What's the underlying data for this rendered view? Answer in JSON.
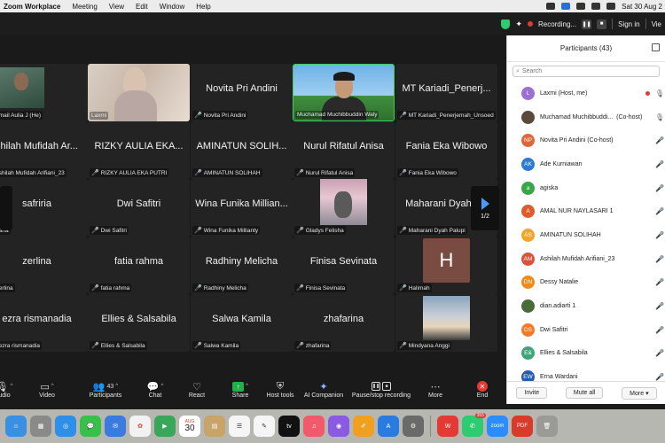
{
  "menubar": {
    "items": [
      "Zoom Workplace",
      "Meeting",
      "View",
      "Edit",
      "Window",
      "Help"
    ],
    "datetime": "Sat 30 Aug 2"
  },
  "titlebar": {
    "recording": "Recording...",
    "signin": "Sign in",
    "view": "Vie"
  },
  "grid": {
    "tiles": [
      {
        "name": "",
        "label": "mail Aulia J (He)",
        "kind": "photo-aulia"
      },
      {
        "name": "",
        "label": "Laxmi",
        "kind": "photo-laxmi"
      },
      {
        "name": "Novita Pri Andini",
        "label": "Novita Pri Andini",
        "kind": "text"
      },
      {
        "name": "",
        "label": "Muchamad Muchibbuddin Waly",
        "kind": "photo-muh"
      },
      {
        "name": "MT Kariadi_Penerj...",
        "label": "MT Kariadi_Penerjemah_Unsoed",
        "kind": "text"
      },
      {
        "name": "shilah Mufidah Ar...",
        "label": "shilah Mufidah Arifiani_23",
        "kind": "text"
      },
      {
        "name": "RIZKY AULIA EKA...",
        "label": "RIZKY AULIA EKA PUTRI",
        "kind": "text"
      },
      {
        "name": "AMINATUN SOLIH...",
        "label": "AMINATUN SOLIHAH",
        "kind": "text"
      },
      {
        "name": "Nurul Rifatul Anisa",
        "label": "Nurul Rifatul Anisa",
        "kind": "text"
      },
      {
        "name": "Fania Eka Wibowo",
        "label": "Fania Eka Wibowo",
        "kind": "text"
      },
      {
        "name": "safriria",
        "label": "aria",
        "kind": "text"
      },
      {
        "name": "Dwi Safitri",
        "label": "Dwi Safitri",
        "kind": "text"
      },
      {
        "name": "Wina Funika Millian...",
        "label": "Wina Funika Millianty",
        "kind": "text"
      },
      {
        "name": "",
        "label": "Gladys Felisha",
        "kind": "photo-gladys"
      },
      {
        "name": "Maharani Dyah P...",
        "label": "Maharani Dyah Palupi",
        "kind": "text"
      },
      {
        "name": "zerlina",
        "label": "erlina",
        "kind": "text"
      },
      {
        "name": "fatia rahma",
        "label": "fatia rahma",
        "kind": "text"
      },
      {
        "name": "Radhiny Melicha",
        "label": "Radhiny Melicha",
        "kind": "text"
      },
      {
        "name": "Finisa Sevinata",
        "label": "Finisa Sevinata",
        "kind": "text"
      },
      {
        "name": "H",
        "label": "Halimah",
        "kind": "avatar"
      },
      {
        "name": "ezra rismanadia",
        "label": "ezra rismanadia",
        "kind": "text"
      },
      {
        "name": "Ellies & Salsabila",
        "label": "Ellies & Salsabila",
        "kind": "text"
      },
      {
        "name": "Salwa Kamila",
        "label": "Salwa Kamila",
        "kind": "text"
      },
      {
        "name": "zhafarina",
        "label": "zhafarina",
        "kind": "text"
      },
      {
        "name": "",
        "label": "Mindyana Anggi",
        "kind": "photo-sky"
      }
    ],
    "page": "1/2"
  },
  "toolbar": {
    "audio": "udio",
    "video": "Video",
    "participants": "Participants",
    "participants_count": "43",
    "chat": "Chat",
    "react": "React",
    "share": "Share",
    "host_tools": "Host tools",
    "ai_companion": "AI Companion",
    "pause_stop": "Pause/stop recording",
    "more": "More",
    "end": "End"
  },
  "panel": {
    "title": "Participants (43)",
    "search_placeholder": "Search",
    "participants": [
      {
        "initials": "L",
        "name": "Laxmi (Host, me)",
        "color": "#9c6fd1",
        "cam": "on",
        "rec": true
      },
      {
        "initials": "",
        "name": "Muchamad Muchibbuddi...",
        "role": "(Co-host)",
        "color": "#5a4a3a",
        "cam": "on",
        "mic": true
      },
      {
        "initials": "NP",
        "name": "Novita Pri Andini (Co-host)",
        "color": "#e0673a",
        "cam": "off"
      },
      {
        "initials": "AK",
        "name": "Ade Kurniawan",
        "color": "#2a7bd1",
        "cam": "off"
      },
      {
        "initials": "a",
        "name": "agiska",
        "color": "#3aa64a",
        "cam": "off"
      },
      {
        "initials": "A",
        "name": "AMAL NUR NAYLASARI 1",
        "color": "#e05a2a",
        "cam": "off"
      },
      {
        "initials": "AS",
        "name": "AMINATUN SOLIHAH",
        "color": "#f0a62a",
        "cam": "off"
      },
      {
        "initials": "AM",
        "name": "Ashilah Mufidah Arifiani_23",
        "color": "#d9533a",
        "cam": "off"
      },
      {
        "initials": "DN",
        "name": "Dessy Natalie",
        "color": "#f08a1a",
        "cam": "off"
      },
      {
        "initials": "",
        "name": "dian.adiarti 1",
        "color": "#4a6a3a",
        "cam": "off"
      },
      {
        "initials": "DS",
        "name": "Dwi Safitri",
        "color": "#f07a2a",
        "cam": "off"
      },
      {
        "initials": "E&",
        "name": "Ellies & Salsabila",
        "color": "#3aa67a",
        "cam": "off"
      },
      {
        "initials": "EW",
        "name": "Erna Wardani",
        "color": "#2a5ab0",
        "cam": "off"
      }
    ],
    "invite": "Invite",
    "mute_all": "Mute all",
    "more": "More"
  },
  "dock": {
    "calendar_month": "AUG",
    "calendar_day": "30",
    "whatsapp_badge": "355",
    "zoom": "zoom",
    "pdf": "PDF",
    "tv": "tv"
  }
}
